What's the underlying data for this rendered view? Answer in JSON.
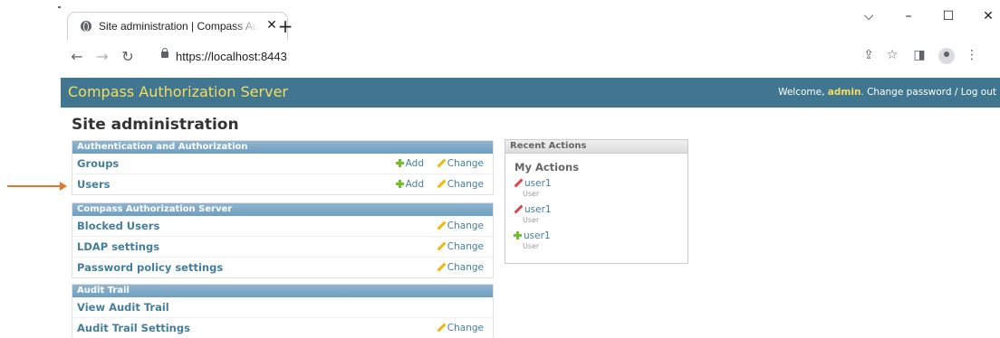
{
  "browser": {
    "tab_title": "Site administration | Compass Authorization Server",
    "tab_close": "✕",
    "new_tab": "+",
    "url": "https://localhost:8443",
    "window_controls": {
      "menu": "⌵",
      "minimize": "–",
      "maximize": "☐",
      "close": "✕"
    }
  },
  "header": {
    "branding": "Compass Authorization Server",
    "welcome": "Welcome,",
    "username": "admin",
    "links": ". Change password / Log out"
  },
  "page": {
    "title": "Site administration"
  },
  "modules": [
    {
      "caption": "Authentication and Authorization",
      "rows": [
        {
          "name": "Groups",
          "add": "Add",
          "change": "Change"
        },
        {
          "name": "Users",
          "add": "Add",
          "change": "Change"
        }
      ]
    },
    {
      "caption": "Compass Authorization Server",
      "rows": [
        {
          "name": "Blocked Users",
          "change": "Change"
        },
        {
          "name": "LDAP settings",
          "change": "Change"
        },
        {
          "name": "Password policy settings",
          "change": "Change"
        }
      ]
    },
    {
      "caption": "Audit Trail",
      "rows": [
        {
          "name": "View Audit Trail"
        },
        {
          "name": "Audit Trail Settings",
          "change": "Change"
        }
      ]
    }
  ],
  "recent_actions": {
    "caption": "Recent Actions",
    "heading": "My Actions",
    "items": [
      {
        "link": "user1",
        "type": "User",
        "icon": "pencil-icon"
      },
      {
        "link": "user1",
        "type": "User",
        "icon": "pencil-icon"
      },
      {
        "link": "user1",
        "type": "User",
        "icon": "plus-icon"
      }
    ]
  },
  "colors": {
    "header_bg": "#417690",
    "branding": "#f5dd5d",
    "link": "#447e9b",
    "caption_bg": "#79aec8",
    "annotation_arrow": "#e0782b"
  }
}
